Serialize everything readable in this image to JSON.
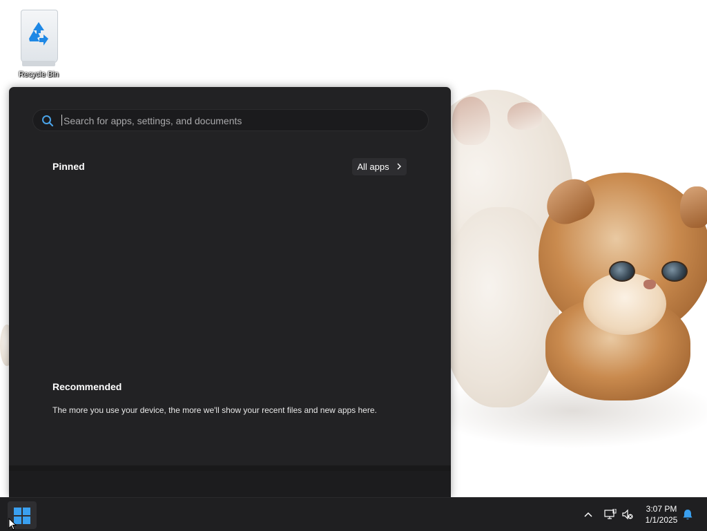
{
  "desktop": {
    "icons": [
      {
        "label": "Recycle Bin",
        "icon": "recycle-bin-icon"
      }
    ],
    "wallpaper": "two-fluffy-kittens"
  },
  "start_menu": {
    "search": {
      "placeholder": "Search for apps, settings, and documents",
      "value": ""
    },
    "pinned": {
      "title": "Pinned",
      "all_apps_label": "All apps"
    },
    "recommended": {
      "title": "Recommended",
      "empty_text": "The more you use your device, the more we'll show your recent files and new apps here."
    }
  },
  "taskbar": {
    "start_icon": "windows-logo-icon",
    "tray_icons": [
      "chevron-up-icon",
      "network-icon",
      "volume-muted-icon",
      "notification-bell-icon"
    ],
    "clock": {
      "time": "3:07 PM",
      "date": "1/1/2025"
    }
  },
  "colors": {
    "start_menu_bg": "#222224",
    "taskbar_bg": "#1f1f21",
    "accent": "#3a8fd8"
  }
}
